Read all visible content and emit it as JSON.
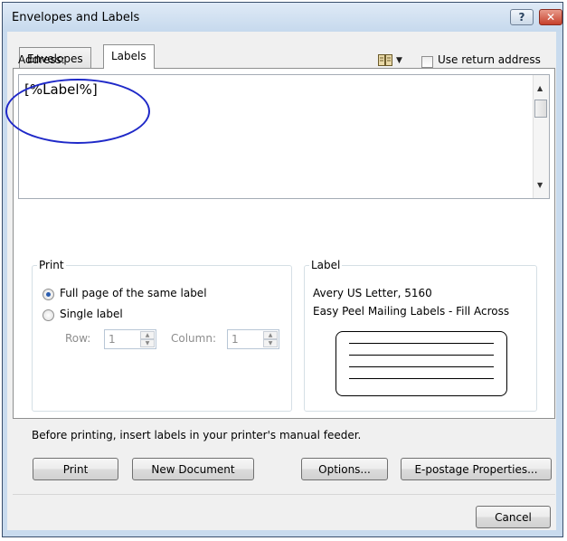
{
  "window": {
    "title": "Envelopes and Labels",
    "help_symbol": "?",
    "close_symbol": "✕"
  },
  "tabs": [
    {
      "label": "Envelopes",
      "active": false
    },
    {
      "label": "Labels",
      "active": true
    }
  ],
  "address": {
    "label": "Address:",
    "value": "[%Label%]",
    "address_book_icon": "address-book-icon",
    "use_return_address": {
      "label": "Use return address",
      "checked": false
    }
  },
  "print_group": {
    "title": "Print",
    "options": [
      {
        "label": "Full page of the same label",
        "checked": true
      },
      {
        "label": "Single label",
        "checked": false
      }
    ],
    "row": {
      "label": "Row:",
      "value": "1"
    },
    "column": {
      "label": "Column:",
      "value": "1"
    }
  },
  "label_group": {
    "title": "Label",
    "line1": "Avery US Letter, 5160",
    "line2": "Easy Peel Mailing Labels - Fill Across"
  },
  "note": "Before printing, insert labels in your printer's manual feeder.",
  "buttons": {
    "print": "Print",
    "new_document": "New Document",
    "options": "Options...",
    "epostage": "E-postage Properties...",
    "cancel": "Cancel"
  },
  "colors": {
    "annotation_ellipse": "#1f29c8",
    "title_bar": "#c6d9ed"
  }
}
